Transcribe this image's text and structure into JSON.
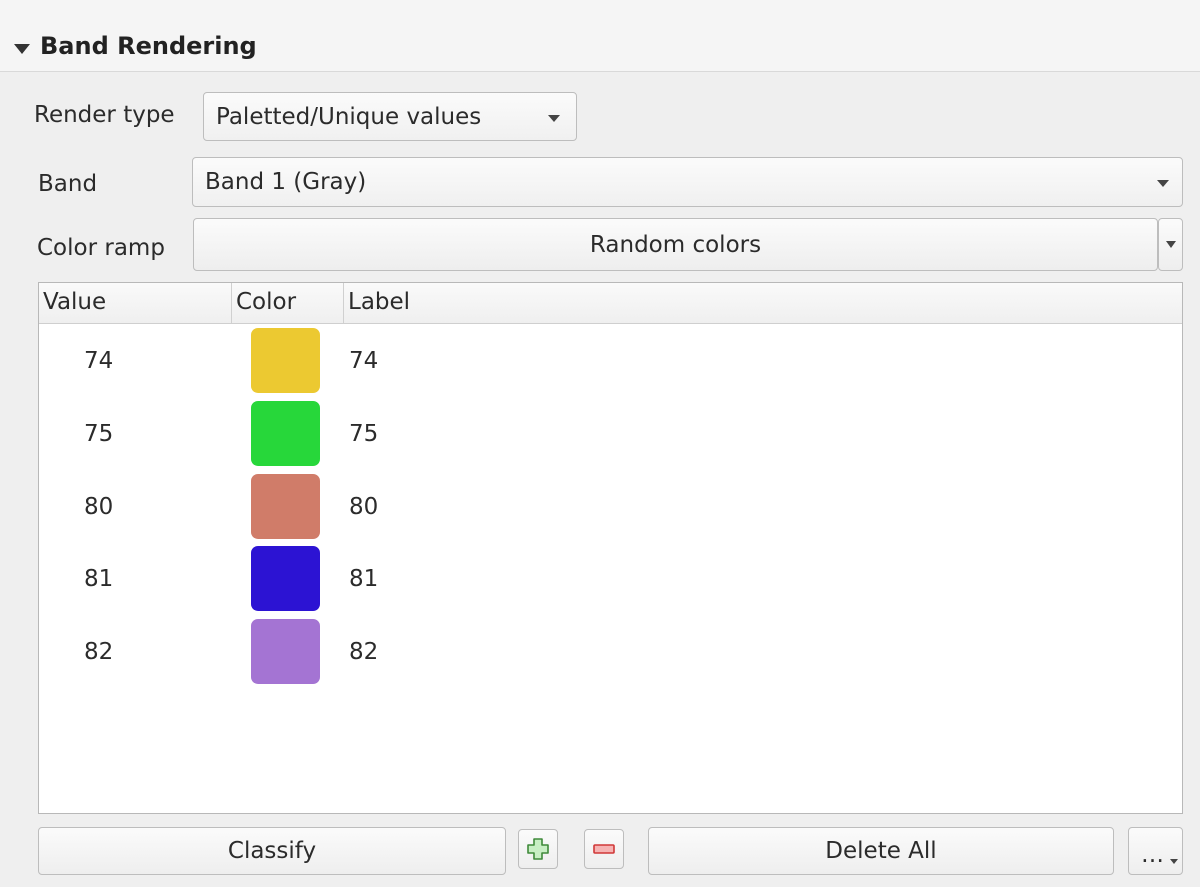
{
  "section": {
    "title": "Band Rendering",
    "icon": "collapse-triangle-icon"
  },
  "render_type": {
    "label": "Render type",
    "value": "Paletted/Unique values"
  },
  "band": {
    "label": "Band",
    "value": "Band 1 (Gray)"
  },
  "color_ramp": {
    "label": "Color ramp",
    "value": "Random colors"
  },
  "table": {
    "headers": {
      "value": "Value",
      "color": "Color",
      "label": "Label"
    },
    "rows": [
      {
        "value": "74",
        "color": "#ecc931",
        "label": "74"
      },
      {
        "value": "75",
        "color": "#27d73a",
        "label": "75"
      },
      {
        "value": "80",
        "color": "#d07c69",
        "label": "80"
      },
      {
        "value": "81",
        "color": "#2c13d3",
        "label": "81"
      },
      {
        "value": "82",
        "color": "#a474d3",
        "label": "82"
      }
    ]
  },
  "buttons": {
    "classify": "Classify",
    "add_icon": "add-value-icon",
    "remove_icon": "remove-value-icon",
    "delete_all": "Delete All",
    "more": "…"
  }
}
